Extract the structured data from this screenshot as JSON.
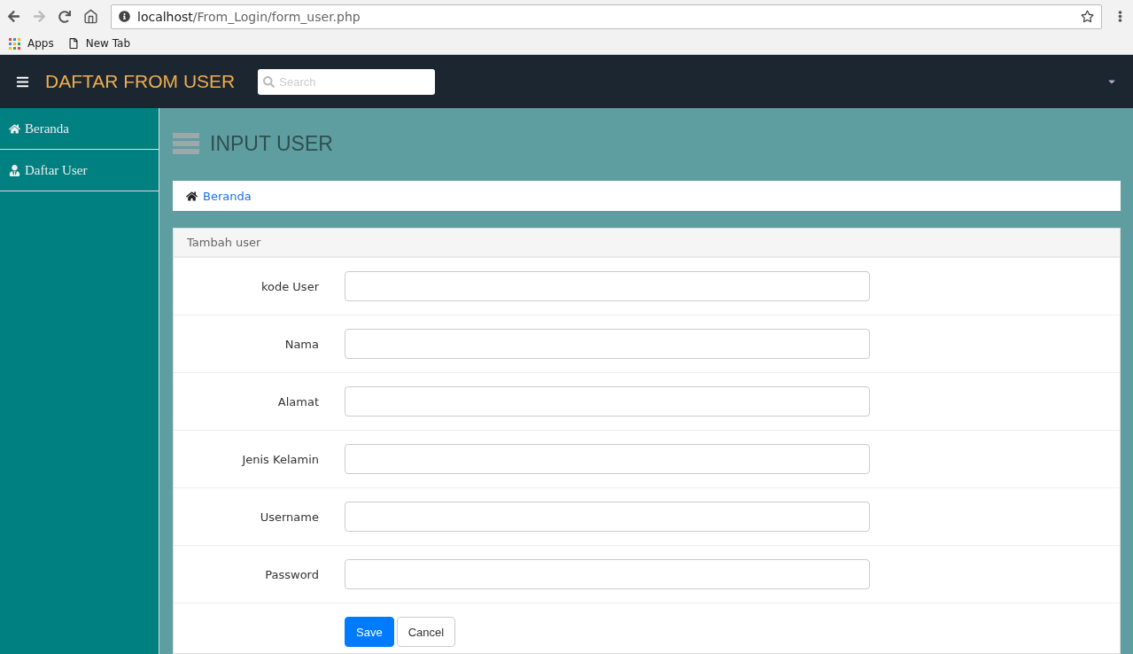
{
  "browser": {
    "url_host": "localhost",
    "url_path": "/From_Login/form_user.php",
    "bookmarks": [
      {
        "kind": "apps",
        "label": "Apps"
      },
      {
        "kind": "page",
        "label": "New Tab"
      }
    ]
  },
  "navbar": {
    "brand": "DAFTAR FROM USER",
    "search": {
      "placeholder": "Search"
    }
  },
  "sidebar": {
    "items": [
      {
        "kind": "home",
        "label": "Beranda"
      },
      {
        "kind": "user",
        "label": "Daftar User"
      }
    ]
  },
  "page_title": "INPUT USER",
  "breadcrumb": {
    "label": "Beranda"
  },
  "panel": {
    "heading": "Tambah user",
    "fields": [
      {
        "label": "kode User"
      },
      {
        "label": "Nama"
      },
      {
        "label": "Alamat"
      },
      {
        "label": "Jenis Kelamin"
      },
      {
        "label": "Username"
      },
      {
        "label": "Password"
      }
    ],
    "buttons": [
      {
        "kind": "primary",
        "label": "Save"
      },
      {
        "kind": "default",
        "label": "Cancel"
      }
    ]
  }
}
